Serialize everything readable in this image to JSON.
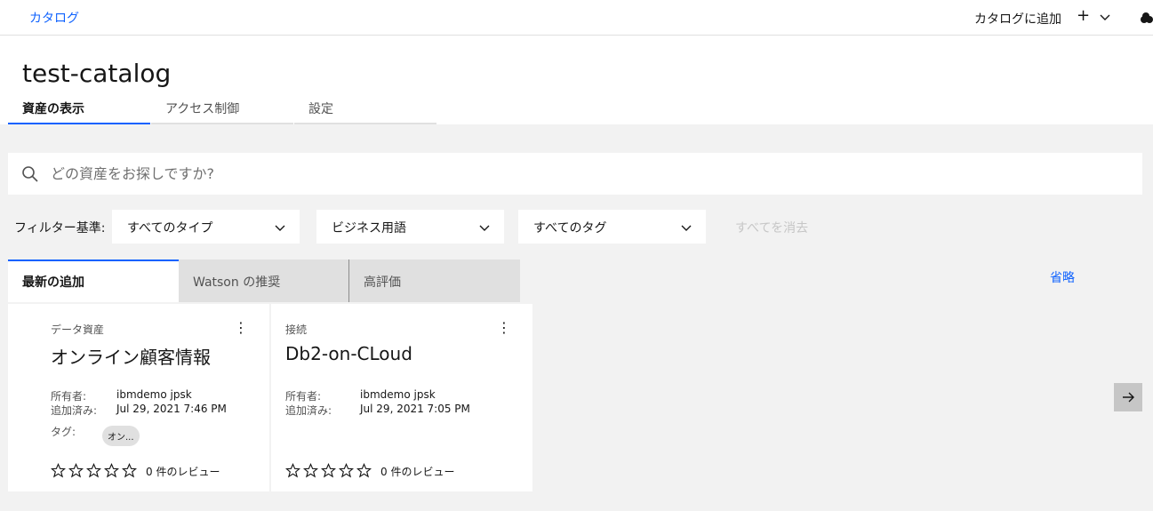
{
  "topbar": {
    "breadcrumb": "カタログ",
    "add_to_catalog": "カタログに追加",
    "plus": "+",
    "icons": [
      "chevron-down-icon",
      "cloud-icon"
    ]
  },
  "header": {
    "title": "test-catalog",
    "tabs": [
      "資産の表示",
      "アクセス制御",
      "設定"
    ]
  },
  "search": {
    "placeholder": "どの資産をお探しですか?"
  },
  "filters": {
    "label": "フィルター基準:",
    "dropdowns": [
      "すべてのタイプ",
      "ビジネス用語",
      "すべてのタグ"
    ],
    "clear_all": "すべてを消去"
  },
  "content_tabs": [
    "最新の追加",
    "Watson の推奨",
    "高評価"
  ],
  "omit_link": "省略",
  "cards": [
    {
      "type": "データ資産",
      "name": "オンライン顧客情報",
      "owner_label": "所有者:",
      "owner": "ibmdemo jpsk",
      "added_label": "追加済み:",
      "added": "Jul 29, 2021 7:46 PM",
      "tags_label": "タグ:",
      "tag": "オン...",
      "reviews": "0 件のレビュー"
    },
    {
      "type": "接続",
      "name": "Db2-on-CLoud",
      "owner_label": "所有者:",
      "owner": "ibmdemo jpsk",
      "added_label": "追加済み:",
      "added": "Jul 29, 2021 7:05 PM",
      "reviews": "0 件のレビュー"
    }
  ],
  "colors": {
    "accent": "#0f62fe",
    "background": "#f2f2f2"
  }
}
